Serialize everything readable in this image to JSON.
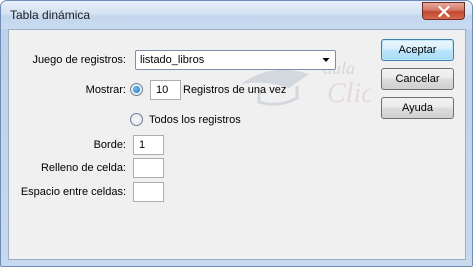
{
  "window": {
    "title": "Tabla dinámica"
  },
  "form": {
    "recordset_label": "Juego de registros:",
    "recordset_value": "listado_libros",
    "show_label": "Mostrar:",
    "show_count": "10",
    "show_suffix": "Registros de una vez",
    "all_records_label": "Todos los registros",
    "border_label": "Borde:",
    "border_value": "1",
    "padding_label": "Relleno de celda:",
    "padding_value": "",
    "spacing_label": "Espacio entre celdas:",
    "spacing_value": ""
  },
  "buttons": {
    "ok": "Aceptar",
    "cancel": "Cancelar",
    "help": "Ayuda"
  },
  "watermark": {
    "line1": "aula",
    "line2": "Clic"
  },
  "state": {
    "show_mode_selected": "count"
  },
  "colors": {
    "titlebar": "#c6d8ee",
    "close_button": "#c2482f",
    "default_button_border": "#3c7fb1",
    "radio_dot": "#1a6bb2",
    "watermark": "#9aa7b8"
  },
  "icons": {
    "close": "close-icon",
    "dropdown": "chevron-down-icon"
  }
}
